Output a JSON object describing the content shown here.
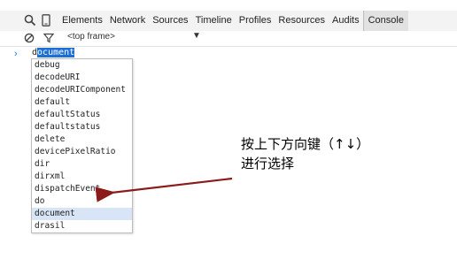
{
  "toolbar": {
    "tabs": [
      "Elements",
      "Network",
      "Sources",
      "Timeline",
      "Profiles",
      "Resources",
      "Audits",
      "Console"
    ],
    "active_tab": "Console",
    "icons": [
      "search-icon",
      "device-icon"
    ]
  },
  "filterbar": {
    "frame_select": "<top frame>",
    "icons": [
      "clear-console-icon",
      "filter-icon"
    ]
  },
  "console": {
    "prompt_prefix": "d",
    "prompt_completion": "ocument"
  },
  "autocomplete": {
    "items": [
      "debug",
      "decodeURI",
      "decodeURIComponent",
      "default",
      "defaultStatus",
      "defaultstatus",
      "delete",
      "devicePixelRatio",
      "dir",
      "dirxml",
      "dispatchEvent",
      "do",
      "document",
      "drasil"
    ],
    "selected": "document"
  },
  "annotation": {
    "line1": "按上下方向键（↑↓）",
    "line2": "进行选择",
    "arrow_color": "#8b1a1a"
  }
}
